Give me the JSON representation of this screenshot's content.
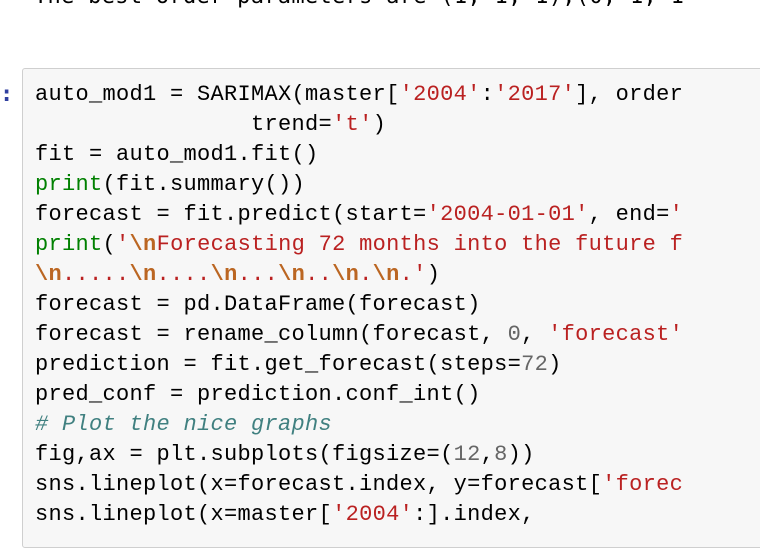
{
  "previous_output": {
    "text": "The best order parameters are (1, 1, 1),(0, 1, 1"
  },
  "cell": {
    "prompt": ":",
    "lines": [
      [
        {
          "t": "auto_mod1 = SARIMAX(master[",
          "k": ""
        },
        {
          "t": "'2004'",
          "k": "s"
        },
        {
          "t": ":",
          "k": ""
        },
        {
          "t": "'2017'",
          "k": "s"
        },
        {
          "t": "], order",
          "k": ""
        }
      ],
      [
        {
          "t": "                trend=",
          "k": ""
        },
        {
          "t": "'t'",
          "k": "s"
        },
        {
          "t": ")",
          "k": ""
        }
      ],
      [
        {
          "t": "fit = auto_mod1.fit()",
          "k": ""
        }
      ],
      [
        {
          "t": "print",
          "k": "b"
        },
        {
          "t": "(fit.summary())",
          "k": ""
        }
      ],
      [
        {
          "t": "forecast = fit.predict(start=",
          "k": ""
        },
        {
          "t": "'2004-01-01'",
          "k": "s"
        },
        {
          "t": ", end=",
          "k": ""
        },
        {
          "t": "'",
          "k": "s"
        }
      ],
      [
        {
          "t": "print",
          "k": "b"
        },
        {
          "t": "(",
          "k": ""
        },
        {
          "t": "'",
          "k": "s"
        },
        {
          "t": "\\n",
          "k": "se"
        },
        {
          "t": "Forecasting 72 months into the future f",
          "k": "s"
        }
      ],
      [
        {
          "t": "\\n",
          "k": "se"
        },
        {
          "t": ".....",
          "k": "s"
        },
        {
          "t": "\\n",
          "k": "se"
        },
        {
          "t": "....",
          "k": "s"
        },
        {
          "t": "\\n",
          "k": "se"
        },
        {
          "t": "...",
          "k": "s"
        },
        {
          "t": "\\n",
          "k": "se"
        },
        {
          "t": "..",
          "k": "s"
        },
        {
          "t": "\\n",
          "k": "se"
        },
        {
          "t": ".",
          "k": "s"
        },
        {
          "t": "\\n",
          "k": "se"
        },
        {
          "t": ".'",
          "k": "s"
        },
        {
          "t": ")",
          "k": ""
        }
      ],
      [
        {
          "t": "forecast = pd.DataFrame(forecast)",
          "k": ""
        }
      ],
      [
        {
          "t": "forecast = rename_column(forecast, ",
          "k": ""
        },
        {
          "t": "0",
          "k": "n"
        },
        {
          "t": ", ",
          "k": ""
        },
        {
          "t": "'forecast'",
          "k": "s"
        }
      ],
      [
        {
          "t": "prediction = fit.get_forecast(steps=",
          "k": ""
        },
        {
          "t": "72",
          "k": "n"
        },
        {
          "t": ")",
          "k": ""
        }
      ],
      [
        {
          "t": "pred_conf = prediction.conf_int()",
          "k": ""
        }
      ],
      [
        {
          "t": "# Plot the nice graphs",
          "k": "c"
        }
      ],
      [
        {
          "t": "fig,ax = plt.subplots(figsize=(",
          "k": ""
        },
        {
          "t": "12",
          "k": "n"
        },
        {
          "t": ",",
          "k": ""
        },
        {
          "t": "8",
          "k": "n"
        },
        {
          "t": "))",
          "k": ""
        }
      ],
      [
        {
          "t": "sns.lineplot(x=forecast.index, y=forecast[",
          "k": ""
        },
        {
          "t": "'forec",
          "k": "s"
        }
      ],
      [
        {
          "t": "sns.lineplot(x=master[",
          "k": ""
        },
        {
          "t": "'2004'",
          "k": "s"
        },
        {
          "t": ":].index,",
          "k": ""
        }
      ]
    ]
  }
}
